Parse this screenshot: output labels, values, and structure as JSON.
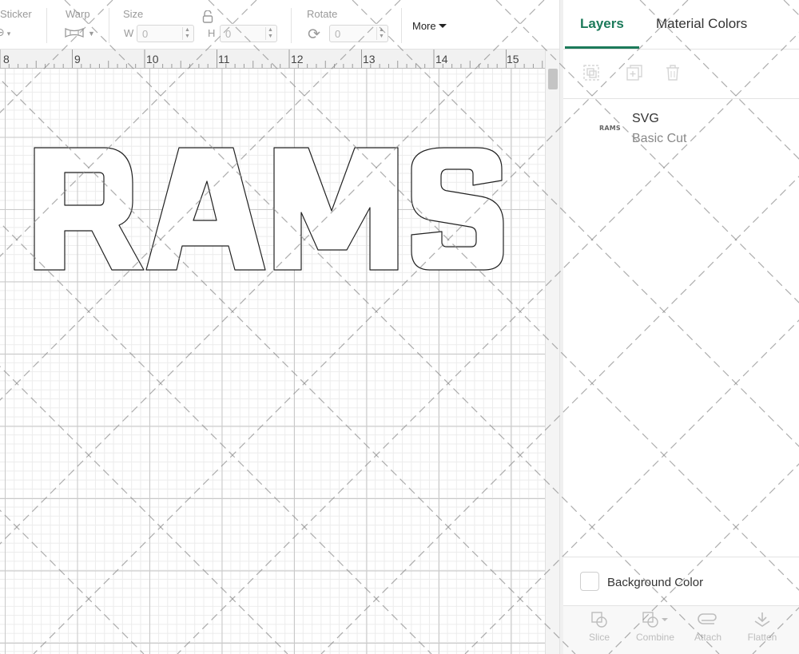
{
  "toolbar": {
    "sticker_label": "Sticker",
    "warp_label": "Warp",
    "size_label": "Size",
    "width_letter": "W",
    "width_value": "0",
    "height_letter": "H",
    "height_value": "0",
    "rotate_label": "Rotate",
    "rotate_value": "0",
    "more_label": "More"
  },
  "ruler": {
    "numbers": [
      "8",
      "9",
      "10",
      "11",
      "12",
      "13",
      "14",
      "15"
    ]
  },
  "canvas": {
    "design_text": "RAMS"
  },
  "panel": {
    "tabs": {
      "layers": "Layers",
      "material_colors": "Material Colors"
    },
    "layers": [
      {
        "thumb_text": "RAMS",
        "name": "SVG",
        "operation": "Basic Cut"
      }
    ],
    "background_color_label": "Background Color",
    "bottom_tools": {
      "slice": "Slice",
      "combine": "Combine",
      "attach": "Attach",
      "flatten": "Flatten"
    }
  },
  "colors": {
    "accent": "#1c7a5a",
    "grid_major": "#c9c9c9",
    "grid_minor": "#ececec"
  }
}
